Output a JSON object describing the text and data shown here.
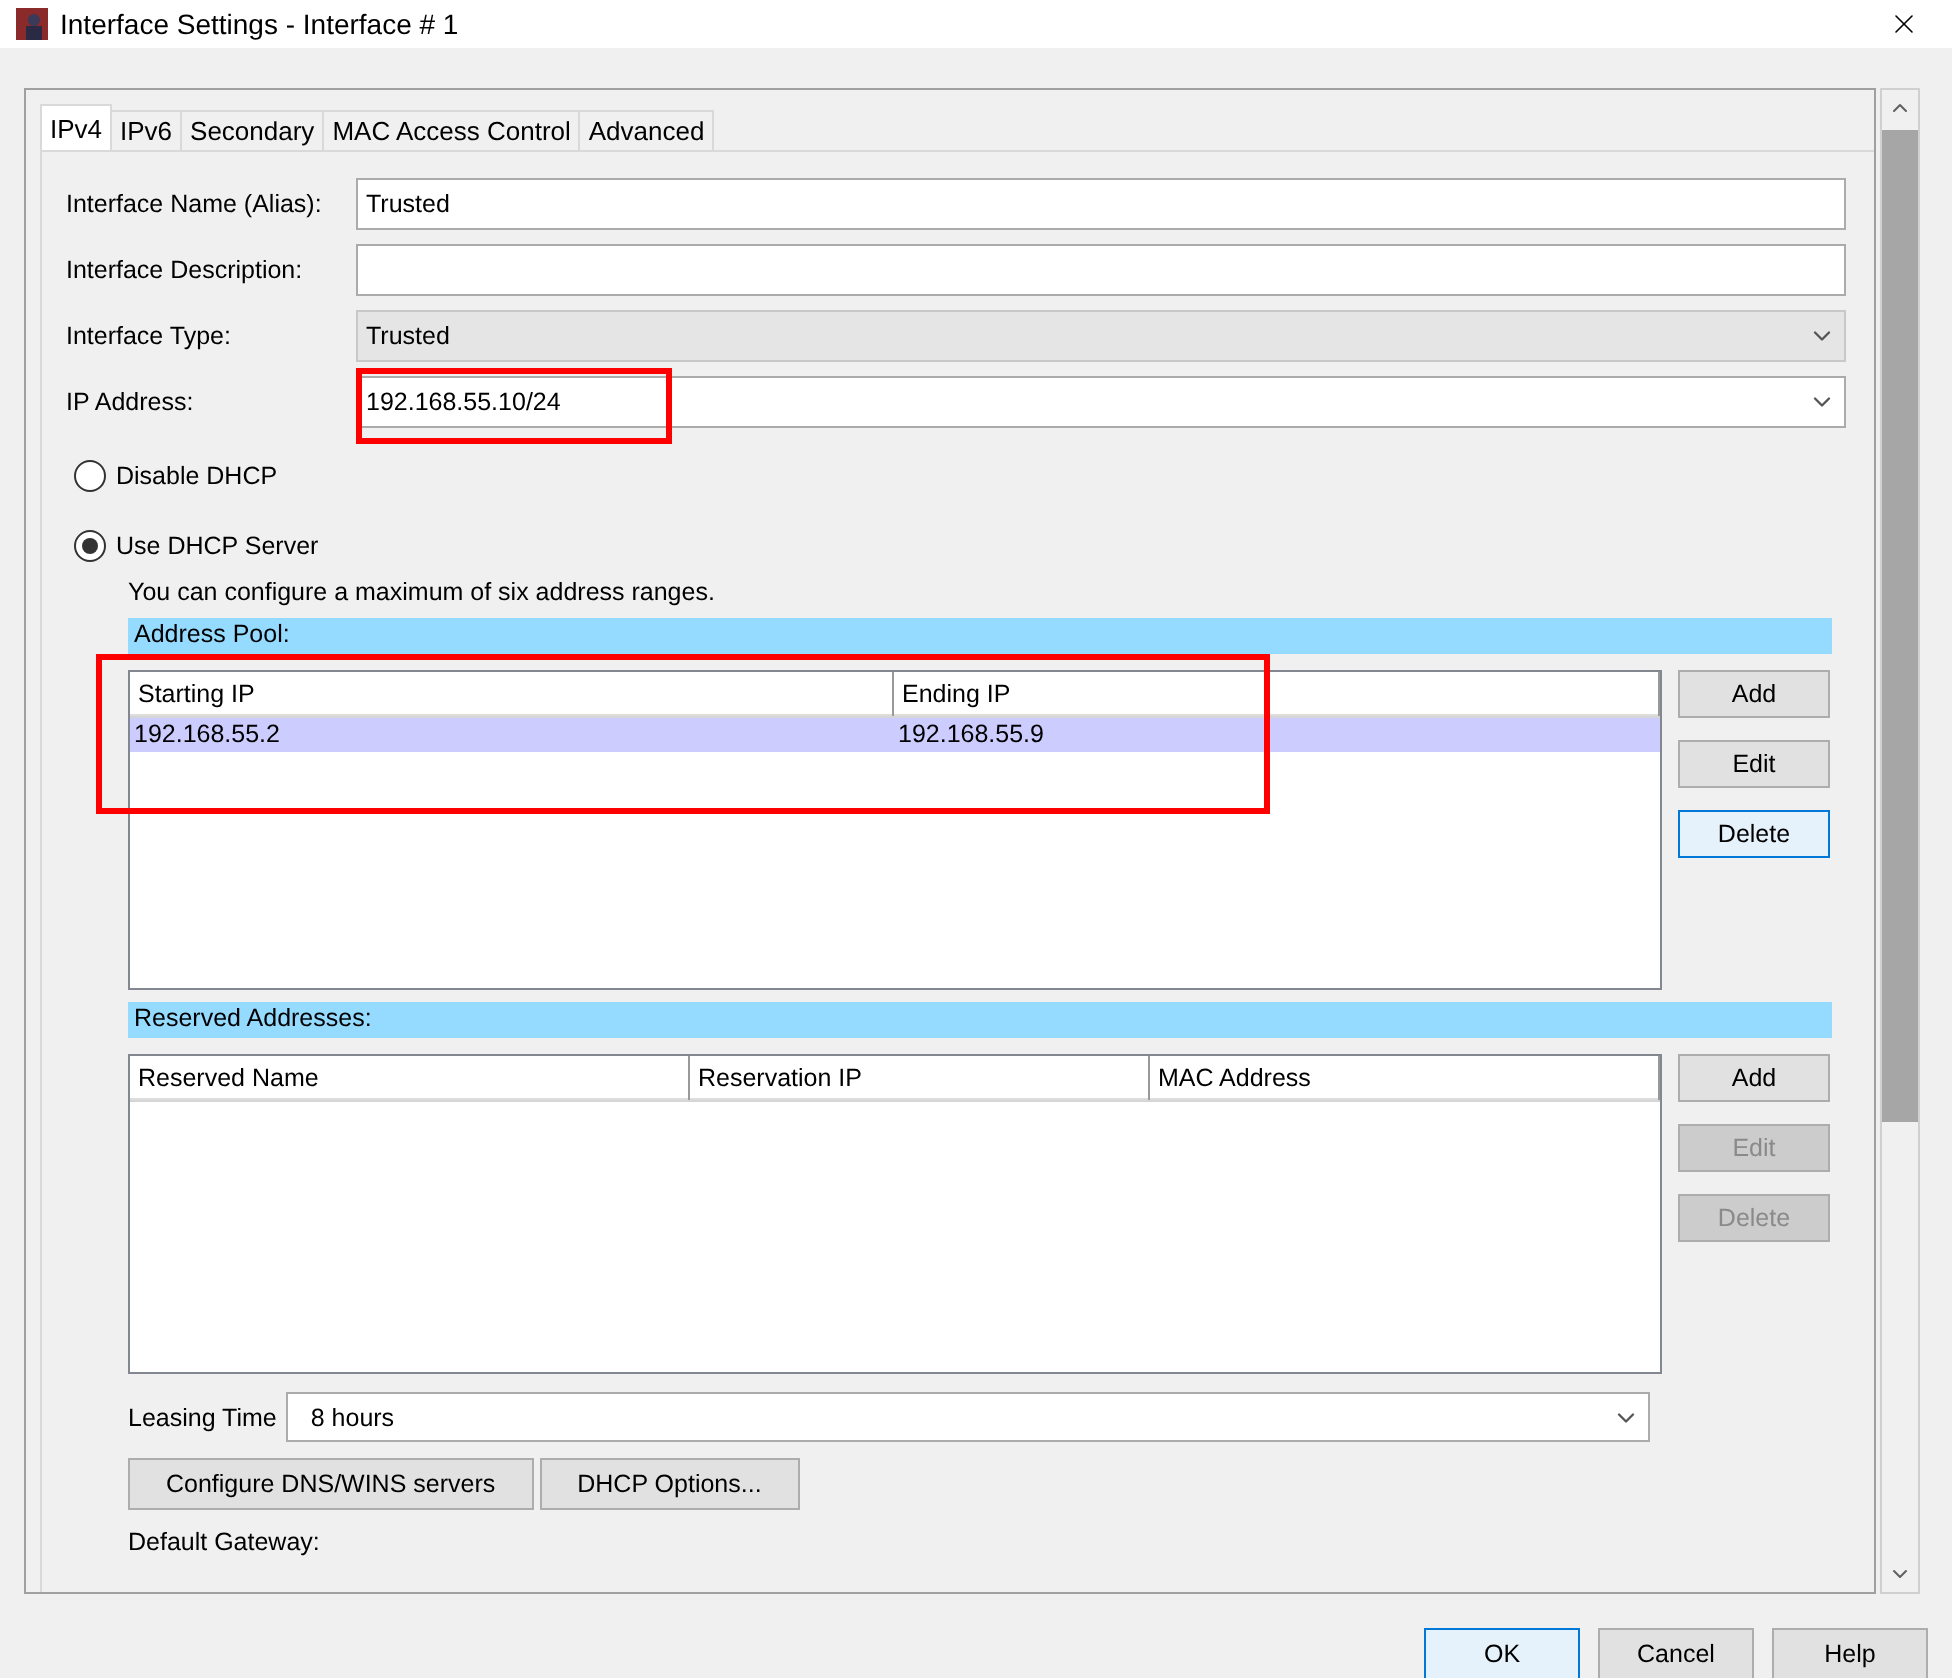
{
  "window": {
    "title": "Interface Settings - Interface # 1"
  },
  "tabs": [
    {
      "label": "IPv4",
      "selected": true
    },
    {
      "label": "IPv6",
      "selected": false
    },
    {
      "label": "Secondary",
      "selected": false
    },
    {
      "label": "MAC Access Control",
      "selected": false
    },
    {
      "label": "Advanced",
      "selected": false
    }
  ],
  "fields": [
    {
      "kind": "text",
      "label": "Interface Name (Alias):",
      "value": "Trusted",
      "highlighted": false
    },
    {
      "kind": "text",
      "label": "Interface Description:",
      "highlighted": false
    },
    {
      "kind": "combo",
      "label": "Interface Type:",
      "value": "Trusted",
      "highlighted": false
    },
    {
      "kind": "editcombo",
      "label": "IP Address:",
      "value": "192.168.55.10/24",
      "highlighted": true
    }
  ],
  "dhcp_mode": [
    {
      "label": "Disable DHCP",
      "selected": false
    },
    {
      "label": "Use DHCP Server",
      "selected": true
    }
  ],
  "hint": "You can configure a maximum of six address ranges.",
  "address_pool": {
    "title": "Address Pool:",
    "highlighted": true,
    "columns": [
      "Starting IP",
      "Ending IP"
    ],
    "rows": [
      {
        "cells": [
          "192.168.55.2",
          "192.168.55.9"
        ],
        "selected": true
      }
    ],
    "buttons": [
      {
        "label": "Add",
        "focused": false,
        "disabled": false
      },
      {
        "label": "Edit",
        "focused": false,
        "disabled": false
      },
      {
        "label": "Delete",
        "focused": true,
        "disabled": false
      }
    ]
  },
  "reserved": {
    "title": "Reserved Addresses:",
    "highlighted": false,
    "columns": [
      "Reserved Name",
      "Reservation IP",
      "MAC Address"
    ],
    "buttons": [
      {
        "label": "Add",
        "focused": false,
        "disabled": false
      },
      {
        "label": "Edit",
        "focused": false,
        "disabled": true
      },
      {
        "label": "Delete",
        "focused": false,
        "disabled": true
      }
    ]
  },
  "leasing": {
    "label": "Leasing Time",
    "value": "8 hours"
  },
  "action_buttons": [
    "Configure DNS/WINS servers",
    "DHCP Options..."
  ],
  "default_gateway_label": "Default Gateway:",
  "dialog_buttons": [
    {
      "label": "OK",
      "focused": true
    },
    {
      "label": "Cancel",
      "focused": false
    },
    {
      "label": "Help",
      "focused": false
    }
  ]
}
